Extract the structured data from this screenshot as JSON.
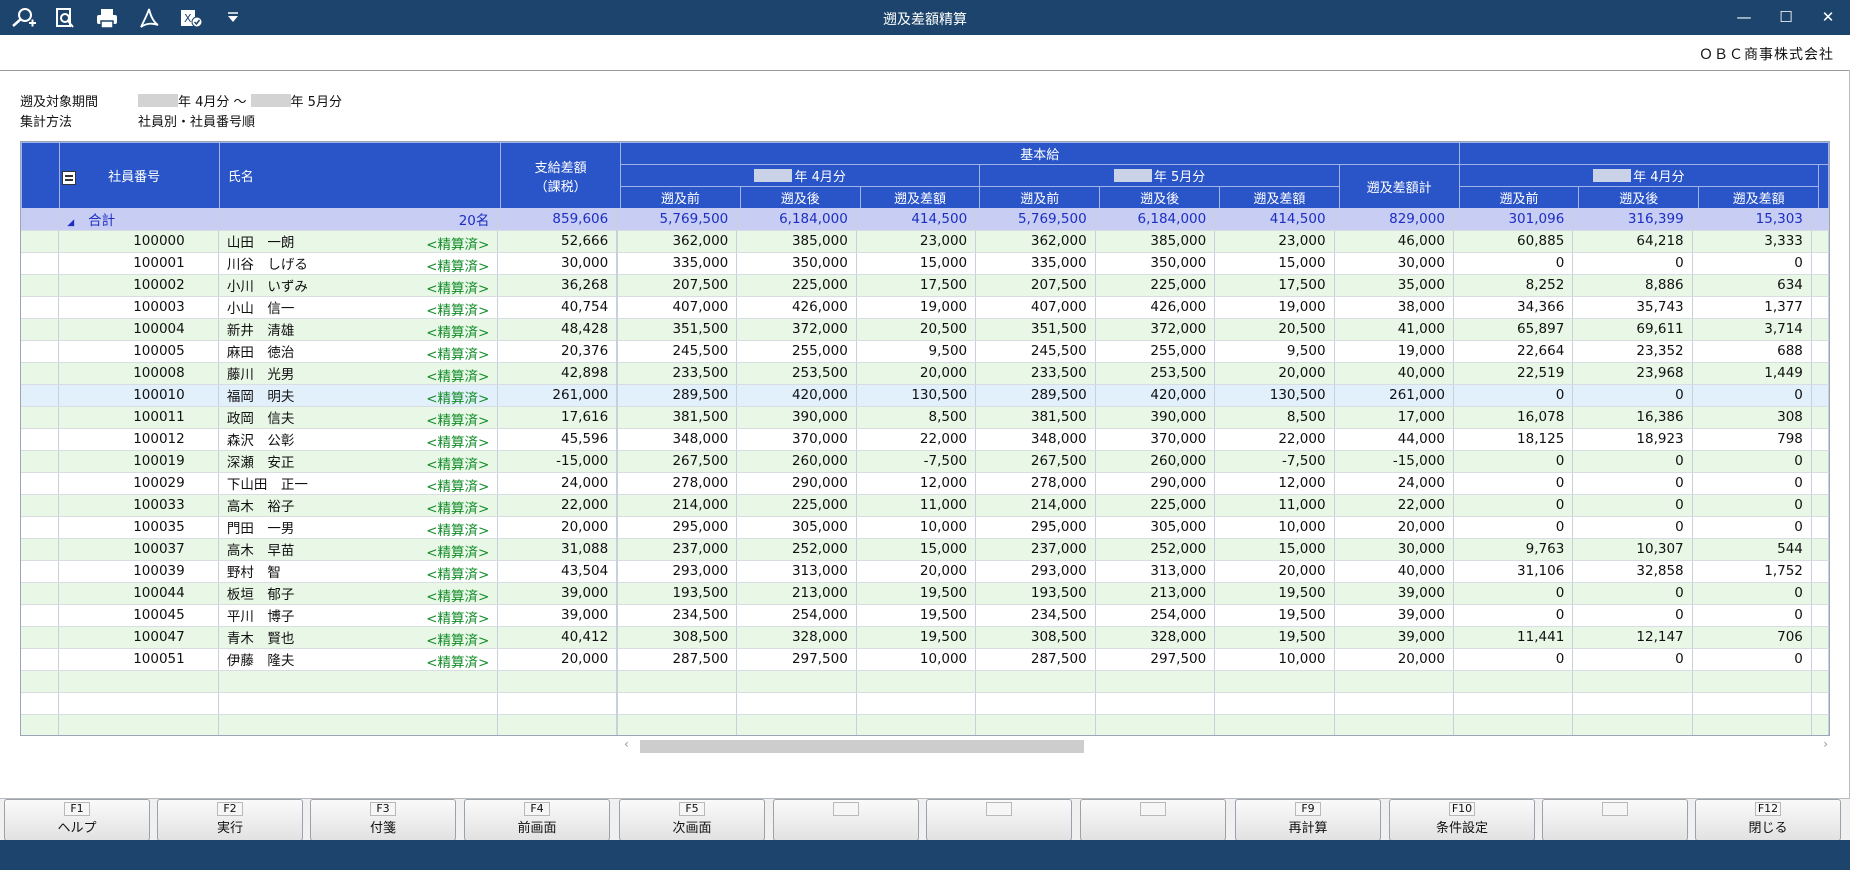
{
  "window": {
    "title": "遡及差額精算",
    "company": "ＯＢＣ商事株式会社"
  },
  "toolbar_icons": [
    "search-plus-icon",
    "preview-icon",
    "print-icon",
    "pdf-icon",
    "excel-icon",
    "dropdown-icon"
  ],
  "window_buttons": {
    "minimize": "—",
    "maximize": "☐",
    "close": "✕"
  },
  "conditions": {
    "period_label": "遡及対象期間",
    "period_from": "年 4月分 ～",
    "period_to": "年 5月分",
    "method_label": "集計方法",
    "method_value": "社員別・社員番号順"
  },
  "headers": {
    "emp_no": "社員番号",
    "name": "氏名",
    "pay_diff": "支給差額",
    "pay_diff_sub": "（課税）",
    "group1": "基本給",
    "m1": "年 4月分",
    "m2": "年 5月分",
    "before": "遡及前",
    "after": "遡及後",
    "diff": "遡及差額",
    "diff_total": "遡及差額計",
    "m3": "年 4月分"
  },
  "total_row": {
    "label": "合計",
    "count": "20名",
    "values": [
      "859,606",
      "5,769,500",
      "6,184,000",
      "414,500",
      "5,769,500",
      "6,184,000",
      "414,500",
      "829,000",
      "301,096",
      "316,399",
      "15,303"
    ]
  },
  "rows": [
    {
      "no": "100000",
      "name": "山田　一朗",
      "status": "<精算済>",
      "values": [
        "52,666",
        "362,000",
        "385,000",
        "23,000",
        "362,000",
        "385,000",
        "23,000",
        "46,000",
        "60,885",
        "64,218",
        "3,333"
      ]
    },
    {
      "no": "100001",
      "name": "川谷　しげる",
      "status": "<精算済>",
      "values": [
        "30,000",
        "335,000",
        "350,000",
        "15,000",
        "335,000",
        "350,000",
        "15,000",
        "30,000",
        "0",
        "0",
        "0"
      ]
    },
    {
      "no": "100002",
      "name": "小川　いずみ",
      "status": "<精算済>",
      "values": [
        "36,268",
        "207,500",
        "225,000",
        "17,500",
        "207,500",
        "225,000",
        "17,500",
        "35,000",
        "8,252",
        "8,886",
        "634"
      ]
    },
    {
      "no": "100003",
      "name": "小山　信一",
      "status": "<精算済>",
      "values": [
        "40,754",
        "407,000",
        "426,000",
        "19,000",
        "407,000",
        "426,000",
        "19,000",
        "38,000",
        "34,366",
        "35,743",
        "1,377"
      ]
    },
    {
      "no": "100004",
      "name": "新井　清雄",
      "status": "<精算済>",
      "values": [
        "48,428",
        "351,500",
        "372,000",
        "20,500",
        "351,500",
        "372,000",
        "20,500",
        "41,000",
        "65,897",
        "69,611",
        "3,714"
      ]
    },
    {
      "no": "100005",
      "name": "麻田　徳治",
      "status": "<精算済>",
      "values": [
        "20,376",
        "245,500",
        "255,000",
        "9,500",
        "245,500",
        "255,000",
        "9,500",
        "19,000",
        "22,664",
        "23,352",
        "688"
      ]
    },
    {
      "no": "100008",
      "name": "藤川　光男",
      "status": "<精算済>",
      "values": [
        "42,898",
        "233,500",
        "253,500",
        "20,000",
        "233,500",
        "253,500",
        "20,000",
        "40,000",
        "22,519",
        "23,968",
        "1,449"
      ]
    },
    {
      "no": "100010",
      "name": "福岡　明夫",
      "status": "<精算済>",
      "values": [
        "261,000",
        "289,500",
        "420,000",
        "130,500",
        "289,500",
        "420,000",
        "130,500",
        "261,000",
        "0",
        "0",
        "0"
      ]
    },
    {
      "no": "100011",
      "name": "政岡　信夫",
      "status": "<精算済>",
      "values": [
        "17,616",
        "381,500",
        "390,000",
        "8,500",
        "381,500",
        "390,000",
        "8,500",
        "17,000",
        "16,078",
        "16,386",
        "308"
      ]
    },
    {
      "no": "100012",
      "name": "森沢　公彰",
      "status": "<精算済>",
      "values": [
        "45,596",
        "348,000",
        "370,000",
        "22,000",
        "348,000",
        "370,000",
        "22,000",
        "44,000",
        "18,125",
        "18,923",
        "798"
      ]
    },
    {
      "no": "100019",
      "name": "深瀬　安正",
      "status": "<精算済>",
      "values": [
        "-15,000",
        "267,500",
        "260,000",
        "-7,500",
        "267,500",
        "260,000",
        "-7,500",
        "-15,000",
        "0",
        "0",
        "0"
      ]
    },
    {
      "no": "100029",
      "name": "下山田　正一",
      "status": "<精算済>",
      "values": [
        "24,000",
        "278,000",
        "290,000",
        "12,000",
        "278,000",
        "290,000",
        "12,000",
        "24,000",
        "0",
        "0",
        "0"
      ]
    },
    {
      "no": "100033",
      "name": "高木　裕子",
      "status": "<精算済>",
      "values": [
        "22,000",
        "214,000",
        "225,000",
        "11,000",
        "214,000",
        "225,000",
        "11,000",
        "22,000",
        "0",
        "0",
        "0"
      ]
    },
    {
      "no": "100035",
      "name": "門田　一男",
      "status": "<精算済>",
      "values": [
        "20,000",
        "295,000",
        "305,000",
        "10,000",
        "295,000",
        "305,000",
        "10,000",
        "20,000",
        "0",
        "0",
        "0"
      ]
    },
    {
      "no": "100037",
      "name": "高木　早苗",
      "status": "<精算済>",
      "values": [
        "31,088",
        "237,000",
        "252,000",
        "15,000",
        "237,000",
        "252,000",
        "15,000",
        "30,000",
        "9,763",
        "10,307",
        "544"
      ]
    },
    {
      "no": "100039",
      "name": "野村　智",
      "status": "<精算済>",
      "values": [
        "43,504",
        "293,000",
        "313,000",
        "20,000",
        "293,000",
        "313,000",
        "20,000",
        "40,000",
        "31,106",
        "32,858",
        "1,752"
      ]
    },
    {
      "no": "100044",
      "name": "板垣　郁子",
      "status": "<精算済>",
      "values": [
        "39,000",
        "193,500",
        "213,000",
        "19,500",
        "193,500",
        "213,000",
        "19,500",
        "39,000",
        "0",
        "0",
        "0"
      ]
    },
    {
      "no": "100045",
      "name": "平川　博子",
      "status": "<精算済>",
      "values": [
        "39,000",
        "234,500",
        "254,000",
        "19,500",
        "234,500",
        "254,000",
        "19,500",
        "39,000",
        "0",
        "0",
        "0"
      ]
    },
    {
      "no": "100047",
      "name": "青木　賢也",
      "status": "<精算済>",
      "values": [
        "40,412",
        "308,500",
        "328,000",
        "19,500",
        "308,500",
        "328,000",
        "19,500",
        "39,000",
        "11,441",
        "12,147",
        "706"
      ]
    },
    {
      "no": "100051",
      "name": "伊藤　隆夫",
      "status": "<精算済>",
      "values": [
        "20,000",
        "287,500",
        "297,500",
        "10,000",
        "287,500",
        "297,500",
        "10,000",
        "20,000",
        "0",
        "0",
        "0"
      ]
    }
  ],
  "fkeys": [
    {
      "key": "F1",
      "label": "ヘルプ"
    },
    {
      "key": "F2",
      "label": "実行"
    },
    {
      "key": "F3",
      "label": "付箋"
    },
    {
      "key": "F4",
      "label": "前画面"
    },
    {
      "key": "F5",
      "label": "次画面"
    },
    {
      "key": "",
      "label": ""
    },
    {
      "key": "",
      "label": ""
    },
    {
      "key": "",
      "label": ""
    },
    {
      "key": "F9",
      "label": "再計算"
    },
    {
      "key": "F10",
      "label": "条件設定"
    },
    {
      "key": "",
      "label": ""
    },
    {
      "key": "F12",
      "label": "閉じる"
    }
  ],
  "colors": {
    "titlebar": "#1c446c",
    "header": "#2a55c8",
    "total_row": "#c7cdf3",
    "alt_row": "#e9f8e6",
    "selected_row": "#e2f0fb",
    "status_text": "#128c28"
  }
}
